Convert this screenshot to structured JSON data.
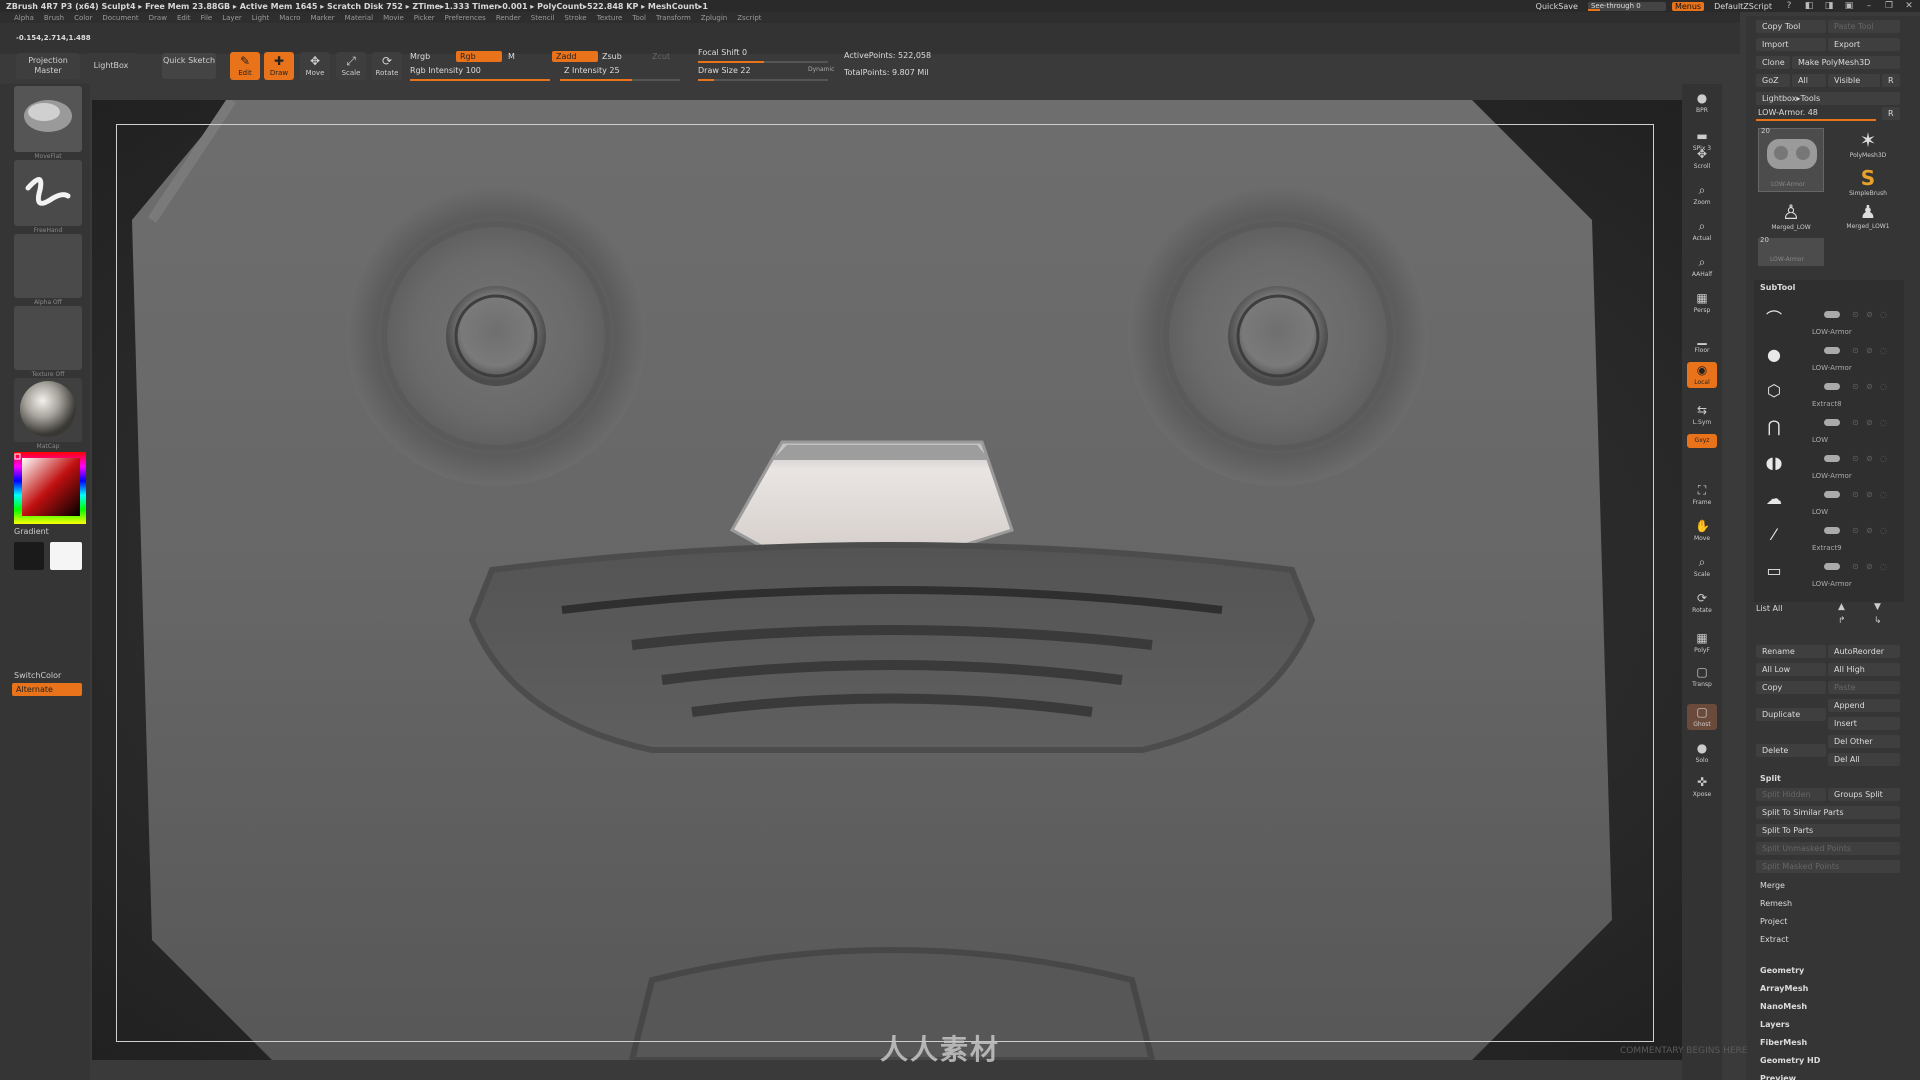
{
  "app": {
    "title": "ZBrush 4R7 P3 (x64)  Sculpt4  ▸ Free Mem 23.88GB ▸ Active Mem 1645 ▸ Scratch Disk 752 ▸ ZTime▸1.333 Timer▸0.001 ▸ PolyCount▸522.848 KP ▸ MeshCount▸1",
    "quicksave": "QuickSave",
    "see_through": "See-through  0",
    "menus": "Menus",
    "default_zscript": "DefaultZScript",
    "coords": "-0.154,2.714,1.488"
  },
  "menubar": [
    "Alpha",
    "Brush",
    "Color",
    "Document",
    "Draw",
    "Edit",
    "File",
    "Layer",
    "Light",
    "Macro",
    "Marker",
    "Material",
    "Movie",
    "Picker",
    "Preferences",
    "Render",
    "Stencil",
    "Stroke",
    "Texture",
    "Tool",
    "Transform",
    "Zplugin",
    "Zscript"
  ],
  "shelf": {
    "projection_master": "Projection Master",
    "lightbox": "LightBox",
    "quick_sketch": "Quick Sketch",
    "edit": "Edit",
    "draw": "Draw",
    "move": "Move",
    "scale": "Scale",
    "rotate": "Rotate",
    "mrgb": "Mrgb",
    "rgb": "Rgb",
    "m": "M",
    "rgb_intensity": "Rgb Intensity 100",
    "zadd": "Zadd",
    "zsub": "Zsub",
    "zcut": "Zcut",
    "z_intensity": "Z Intensity 25",
    "focal_shift": "Focal Shift 0",
    "draw_size": "Draw Size 22",
    "dynamic": "Dynamic",
    "active_points": "ActivePoints: 522,058",
    "total_points": "TotalPoints: 9.807 Mil"
  },
  "left": {
    "brush_label": "MoveFlat",
    "stroke_label": "FreeHand",
    "alpha_label": "Alpha Off",
    "texture_label": "Texture Off",
    "material_label": "MatCap",
    "gradient": "Gradient",
    "switch_color": "SwitchColor",
    "alternate": "Alternate"
  },
  "viewtools": [
    {
      "name": "bpr",
      "label": "BPR"
    },
    {
      "name": "spix",
      "label": "SPix 3"
    },
    {
      "name": "scroll",
      "label": "Scroll"
    },
    {
      "name": "zoom",
      "label": "Zoom"
    },
    {
      "name": "actual",
      "label": "Actual"
    },
    {
      "name": "aahalf",
      "label": "AAHalf"
    },
    {
      "name": "persp",
      "label": "Persp"
    },
    {
      "name": "floor",
      "label": "Floor"
    },
    {
      "name": "local",
      "label": "Local"
    },
    {
      "name": "lsym",
      "label": "L.Sym"
    },
    {
      "name": "xyz",
      "label": "Gxyz"
    },
    {
      "name": "frame",
      "label": "Frame"
    },
    {
      "name": "move",
      "label": "Move"
    },
    {
      "name": "scale",
      "label": "Scale"
    },
    {
      "name": "rotate",
      "label": "Rotate"
    },
    {
      "name": "polyf",
      "label": "PolyF"
    },
    {
      "name": "transp",
      "label": "Transp"
    },
    {
      "name": "ghost",
      "label": "Ghost"
    },
    {
      "name": "solo",
      "label": "Solo"
    },
    {
      "name": "xpose",
      "label": "Xpose"
    }
  ],
  "tool": {
    "copy_tool": "Copy Tool",
    "paste_tool": "Paste Tool",
    "import": "Import",
    "export": "Export",
    "clone": "Clone",
    "make_polymesh": "Make PolyMesh3D",
    "goz": "GoZ",
    "all": "All",
    "visible": "Visible",
    "r": "R",
    "lightbox_tools": "Lightbox▸Tools",
    "current": "LOW-Armor. 48",
    "thumbs": [
      {
        "label": "LOW-Armor",
        "num": "20"
      },
      {
        "label": "PolyMesh3D"
      },
      {
        "label": "SimpleBrush"
      },
      {
        "label": "Merged_LOW"
      },
      {
        "label": "Merged_LOW1"
      },
      {
        "label": "LOW-Armor",
        "num": "20"
      }
    ]
  },
  "subtool": {
    "title": "SubTool",
    "items": [
      "LOW-Armor",
      "LOW-Armor",
      "Extract8",
      "LOW",
      "LOW-Armor",
      "LOW",
      "Extract9",
      "LOW-Armor"
    ],
    "list_all": "List All",
    "rename": "Rename",
    "autoreorder": "AutoReorder",
    "all_low": "All Low",
    "all_high": "All High",
    "copy": "Copy",
    "paste": "Paste",
    "append": "Append",
    "duplicate": "Duplicate",
    "insert": "Insert",
    "delete": "Delete",
    "del_other": "Del Other",
    "del_all": "Del All",
    "split": "Split",
    "split_hidden": "Split Hidden",
    "groups_split": "Groups Split",
    "split_similar": "Split To Similar Parts",
    "split_parts": "Split To Parts",
    "split_unmasked": "Split Unmasked Points",
    "split_masked": "Split Masked Points",
    "merge": "Merge",
    "remesh": "Remesh",
    "project": "Project",
    "extract": "Extract",
    "sections": [
      "Geometry",
      "ArrayMesh",
      "NanoMesh",
      "Layers",
      "FiberMesh",
      "Geometry HD",
      "Preview"
    ]
  },
  "watermark": "人人素材",
  "watermark_en": "COMMENTARY BEGINS HERE",
  "colors": {
    "accent": "#e8731a",
    "panel": "#353535",
    "mesh": "#6b6b6b"
  }
}
